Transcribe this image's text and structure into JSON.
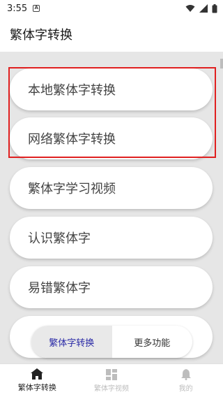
{
  "status_bar": {
    "time": "3:55",
    "notif_letter": "A"
  },
  "app_bar": {
    "title": "繁体字转换"
  },
  "menu": {
    "items": [
      {
        "label": "本地繁体字转换"
      },
      {
        "label": "网络繁体字转换"
      },
      {
        "label": "繁体字学习视频"
      },
      {
        "label": "认识繁体字"
      },
      {
        "label": "易错繁体字"
      },
      {
        "label": ""
      }
    ]
  },
  "segmented": {
    "left_label": "繁体字转换",
    "right_label": "更多功能"
  },
  "bottom_nav": {
    "items": [
      {
        "label": "繁体字转换",
        "icon": "home-icon"
      },
      {
        "label": "繁体字视频",
        "icon": "grid-icon"
      },
      {
        "label": "我的",
        "icon": "bell-icon"
      }
    ]
  },
  "colors": {
    "highlight": "#e02020",
    "accent": "#2a2aa6"
  }
}
